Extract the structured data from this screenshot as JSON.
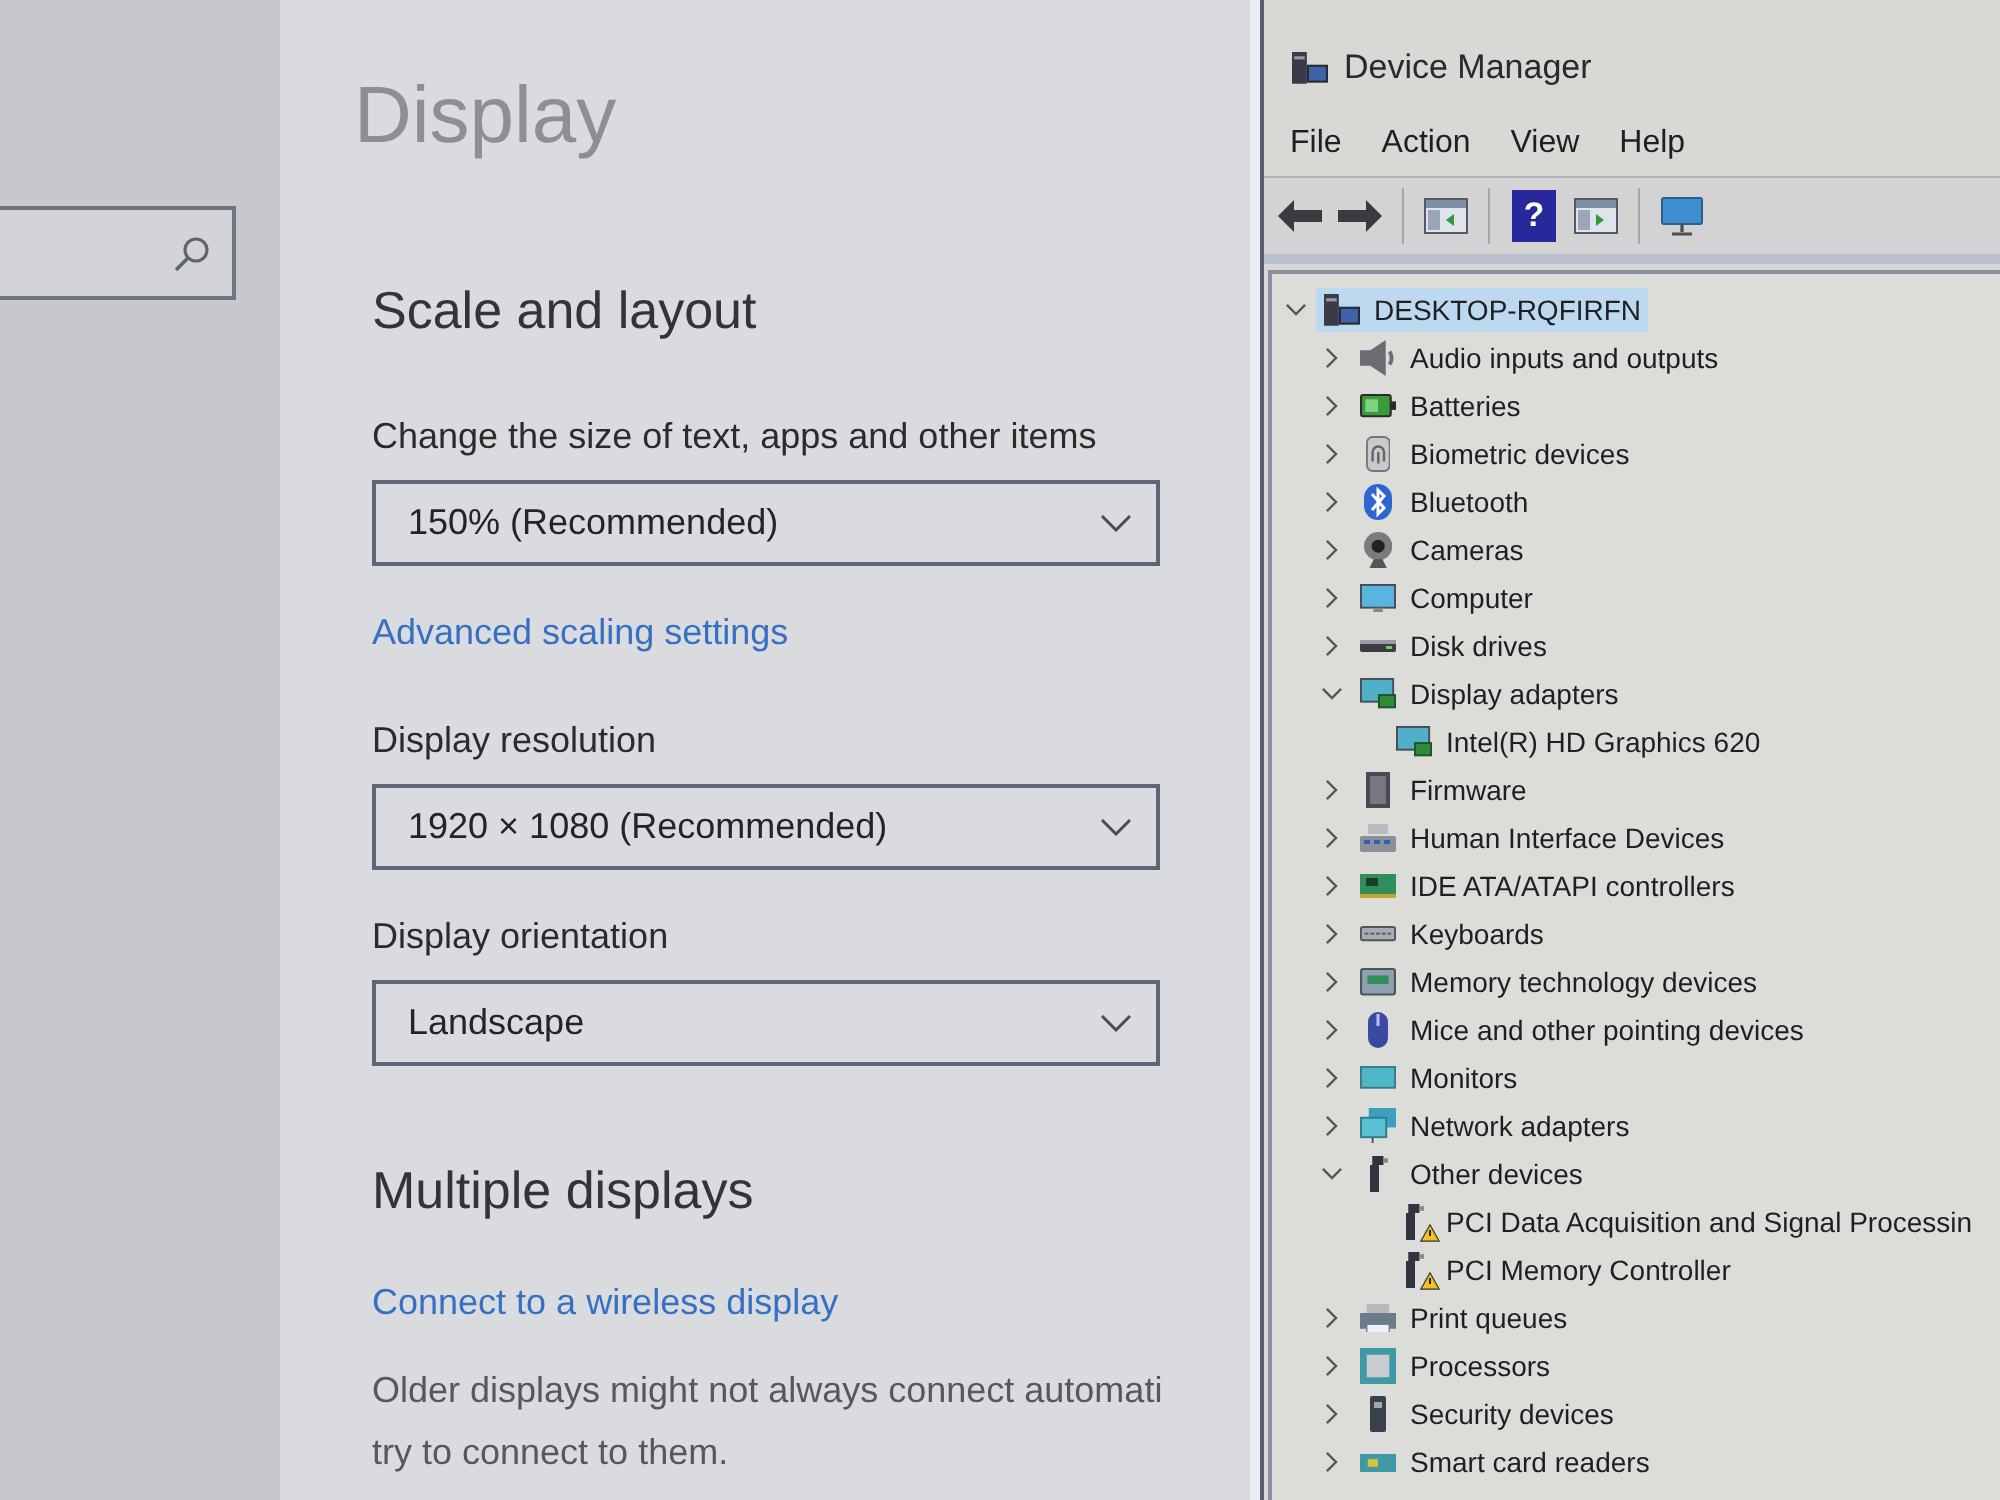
{
  "settings": {
    "title": "Display",
    "sections": [
      {
        "heading": "Scale and layout",
        "controls": [
          {
            "kind": "dropdown",
            "label": "Change the size of text, apps and other items",
            "value": "150% (Recommended)"
          },
          {
            "kind": "link",
            "text": "Advanced scaling settings"
          },
          {
            "kind": "dropdown",
            "label": "Display resolution",
            "value": "1920 × 1080 (Recommended)"
          },
          {
            "kind": "dropdown",
            "label": "Display orientation",
            "value": "Landscape"
          }
        ]
      },
      {
        "heading": "Multiple displays",
        "controls": [
          {
            "kind": "link",
            "text": "Connect to a wireless display"
          },
          {
            "kind": "text",
            "lines": [
              "Older displays might not always connect automati",
              "try to connect to them."
            ]
          }
        ]
      }
    ]
  },
  "device_manager": {
    "title": "Device Manager",
    "menu": [
      "File",
      "Action",
      "View",
      "Help"
    ],
    "toolbar": {
      "help_label": "?"
    },
    "tree": [
      {
        "label": "DESKTOP-RQFIRFN",
        "kind": "pc",
        "expanded": true,
        "selected": true,
        "children": [
          {
            "label": "Audio inputs and outputs",
            "kind": "audio",
            "expanded": false,
            "selected": false
          },
          {
            "label": "Batteries",
            "kind": "battery",
            "expanded": false,
            "selected": false
          },
          {
            "label": "Biometric devices",
            "kind": "biometric",
            "expanded": false,
            "selected": false
          },
          {
            "label": "Bluetooth",
            "kind": "bluetooth",
            "expanded": false,
            "selected": false
          },
          {
            "label": "Cameras",
            "kind": "camera",
            "expanded": false,
            "selected": false
          },
          {
            "label": "Computer",
            "kind": "computer",
            "expanded": false,
            "selected": false
          },
          {
            "label": "Disk drives",
            "kind": "disk",
            "expanded": false,
            "selected": false
          },
          {
            "label": "Display adapters",
            "kind": "display",
            "expanded": true,
            "selected": false,
            "children": [
              {
                "label": "Intel(R) HD Graphics 620",
                "kind": "display",
                "selected": false
              }
            ]
          },
          {
            "label": "Firmware",
            "kind": "firmware",
            "expanded": false,
            "selected": false
          },
          {
            "label": "Human Interface Devices",
            "kind": "hid",
            "expanded": false,
            "selected": false
          },
          {
            "label": "IDE ATA/ATAPI controllers",
            "kind": "ide",
            "expanded": false,
            "selected": false
          },
          {
            "label": "Keyboards",
            "kind": "keyboard",
            "expanded": false,
            "selected": false
          },
          {
            "label": "Memory technology devices",
            "kind": "memory",
            "expanded": false,
            "selected": false
          },
          {
            "label": "Mice and other pointing devices",
            "kind": "mouse",
            "expanded": false,
            "selected": false
          },
          {
            "label": "Monitors",
            "kind": "monitor",
            "expanded": false,
            "selected": false
          },
          {
            "label": "Network adapters",
            "kind": "network",
            "expanded": false,
            "selected": false
          },
          {
            "label": "Other devices",
            "kind": "unknown",
            "expanded": true,
            "selected": false,
            "children": [
              {
                "label": "PCI Data Acquisition and Signal Processin",
                "kind": "unknown",
                "warning": true,
                "selected": false
              },
              {
                "label": "PCI Memory Controller",
                "kind": "unknown",
                "warning": true,
                "selected": false
              }
            ]
          },
          {
            "label": "Print queues",
            "kind": "printer",
            "expanded": false,
            "selected": false
          },
          {
            "label": "Processors",
            "kind": "processor",
            "expanded": false,
            "selected": false
          },
          {
            "label": "Security devices",
            "kind": "security",
            "expanded": false,
            "selected": false
          },
          {
            "label": "Smart card readers",
            "kind": "smartcard",
            "expanded": false,
            "selected": false
          }
        ]
      }
    ]
  }
}
